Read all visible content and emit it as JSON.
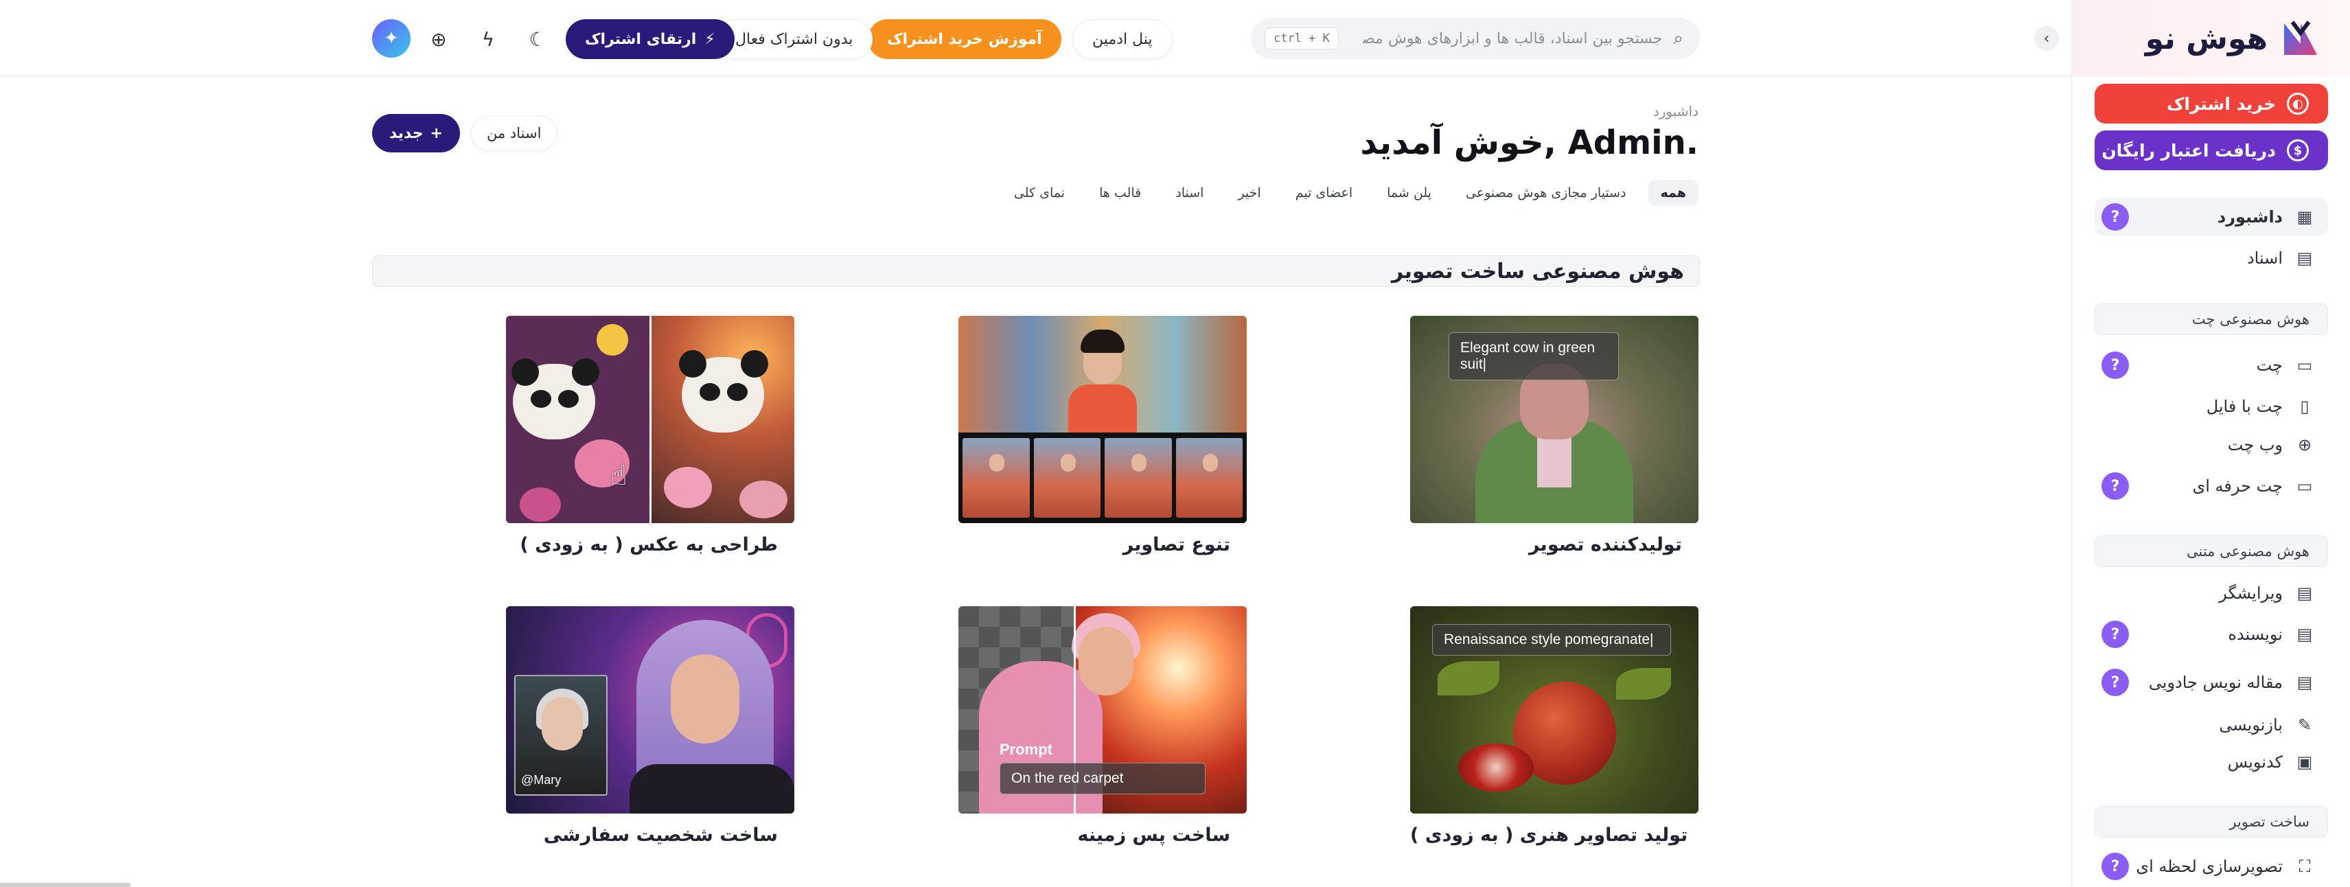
{
  "sidebar": {
    "brand_name": "هوش نو",
    "buy_subscription": "خرید اشتراک",
    "free_credit": "دریافت اعتبار رایگان",
    "items": [
      {
        "label": "داشبورد",
        "icon": "grid-icon",
        "badge": "?"
      },
      {
        "label": "اسناد",
        "icon": "archive-icon"
      }
    ],
    "sections": [
      {
        "title": "هوش مصنوعی چت",
        "items": [
          {
            "label": "چت",
            "icon": "chat-icon",
            "badge": "?"
          },
          {
            "label": "چت با فایل",
            "icon": "file-icon"
          },
          {
            "label": "وب چت",
            "icon": "globe-icon"
          },
          {
            "label": "چت حرفه ای",
            "icon": "pro-chat-icon",
            "badge": "?"
          }
        ]
      },
      {
        "title": "هوش مصنوعی متنی",
        "items": [
          {
            "label": "ویرایشگر",
            "icon": "editor-icon"
          },
          {
            "label": "نویسنده",
            "icon": "writer-icon",
            "badge": "?"
          },
          {
            "label": "مقاله نویس جادویی",
            "icon": "article-icon",
            "badge": "?"
          },
          {
            "label": "بازنویسی",
            "icon": "pen-icon"
          },
          {
            "label": "کدنویس",
            "icon": "code-icon"
          }
        ]
      },
      {
        "title": "ساخت تصویر",
        "items": [
          {
            "label": "تصویرسازی لحظه ای",
            "icon": "instant-image-icon",
            "badge": "?"
          }
        ]
      }
    ]
  },
  "header": {
    "search_placeholder": "جستجو بین اسناد، قالب ها و ابزارهای هوش مصنوعی",
    "shortcut": "ctrl + K",
    "admin_panel": "پنل ادمین",
    "tutorial": "آموزش خرید اشتراک",
    "no_subscription": "بدون اشتراک فعال",
    "upgrade": "ارتقای اشتراک"
  },
  "main": {
    "breadcrumb": "داشبورد",
    "welcome": "خوش آمدید, Admin.",
    "my_docs": "اسناد من",
    "new_button": "جدید",
    "tabs": [
      "همه",
      "دستیار مجازی هوش مصنوعی",
      "پلن شما",
      "اعضای تیم",
      "اخیر",
      "اسناد",
      "قالب ها",
      "نمای کلی"
    ],
    "section_title": "هوش مصنوعی ساخت تصویر",
    "cards": [
      {
        "title": "تولیدکننده تصویر",
        "overlay": "Elegant cow in green suit|"
      },
      {
        "title": "تنوع تصاویر"
      },
      {
        "title": "طراحی به عکس ( به زودی )"
      },
      {
        "title": "تولید تصاویر هنری ( به زودی )",
        "overlay": "Renaissance style pomegranate|"
      },
      {
        "title": "ساخت پس زمینه",
        "overlay_label": "Prompt",
        "overlay": "On the red carpet"
      },
      {
        "title": "ساخت شخصیت سفارشی",
        "overlay": "@Mary"
      }
    ]
  },
  "colors": {
    "accent": "#2c1a7a",
    "buy_red": "#f0413a",
    "credit_purple": "#6a32c9",
    "tutorial_orange": "#f7911e",
    "badge_purple": "#8b5cf6"
  }
}
